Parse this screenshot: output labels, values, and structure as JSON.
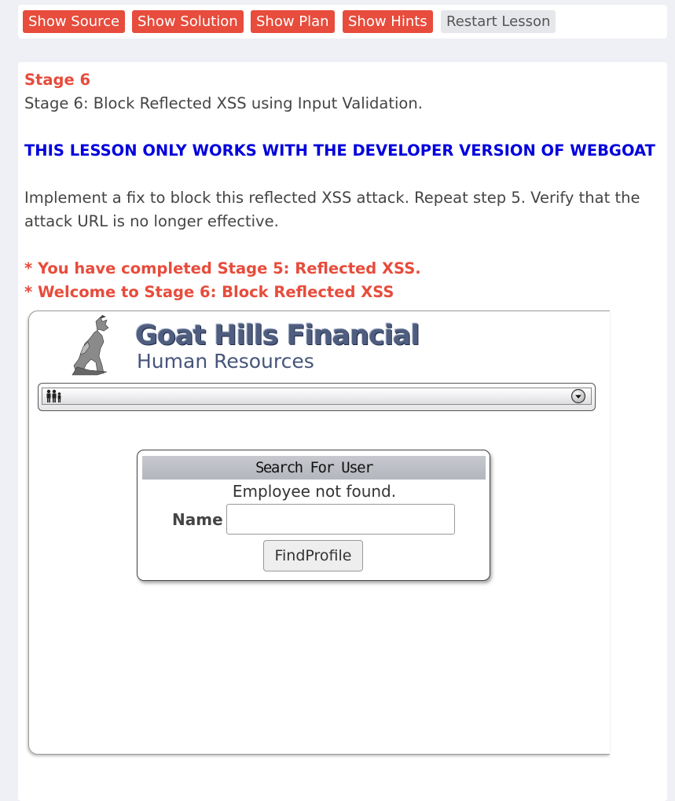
{
  "toolbar": {
    "show_source": "Show Source",
    "show_solution": "Show Solution",
    "show_plan": "Show Plan",
    "show_hints": "Show Hints",
    "restart_lesson": "Restart Lesson"
  },
  "lesson": {
    "stage_title": "Stage 6",
    "stage_desc": "Stage 6: Block Reflected XSS using Input Validation.",
    "warning": "THIS LESSON ONLY WORKS WITH THE DEVELOPER VERSION OF WEBGOAT",
    "instruction_line1": "Implement a fix to block this reflected XSS attack. Repeat step 5. Verify that the",
    "instruction_line2": "attack URL is no longer effective.",
    "completed_msg": "* You have completed Stage 5: Reflected XSS.",
    "welcome_msg": "* Welcome to Stage 6: Block Reflected XSS"
  },
  "app": {
    "logo_title": "Goat Hills Financial",
    "logo_subtitle": "Human Resources",
    "search": {
      "header": "Search For User",
      "status": "Employee not found.",
      "name_label": "Name",
      "name_value": "",
      "button": "FindProfile"
    }
  },
  "colors": {
    "accent": "#e74c3c",
    "warning_blue": "#0000dd",
    "logo_blue": "#4f5d7e"
  }
}
